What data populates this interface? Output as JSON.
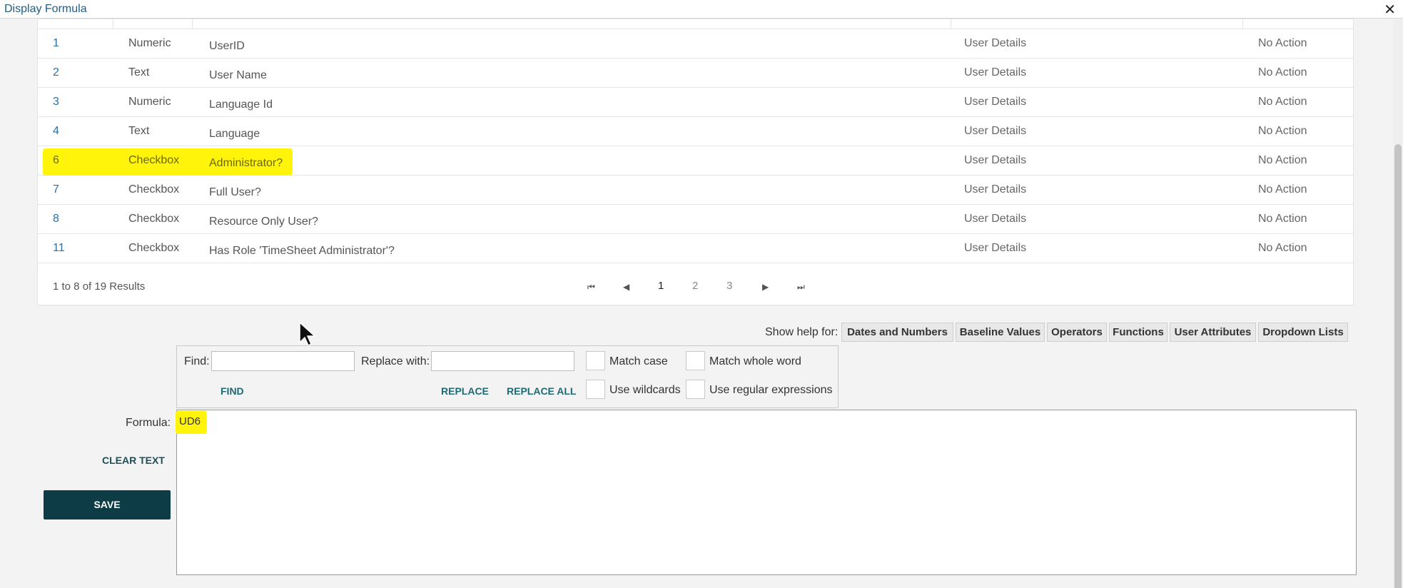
{
  "window": {
    "title": "Display Formula",
    "close_symbol": "✕"
  },
  "table": {
    "rows": [
      {
        "id": "1",
        "type": "Numeric",
        "name": "UserID",
        "source": "User Details",
        "action": "No Action",
        "highlighted": false
      },
      {
        "id": "2",
        "type": "Text",
        "name": "User Name",
        "source": "User Details",
        "action": "No Action",
        "highlighted": false
      },
      {
        "id": "3",
        "type": "Numeric",
        "name": "Language Id",
        "source": "User Details",
        "action": "No Action",
        "highlighted": false
      },
      {
        "id": "4",
        "type": "Text",
        "name": "Language",
        "source": "User Details",
        "action": "No Action",
        "highlighted": false
      },
      {
        "id": "6",
        "type": "Checkbox",
        "name": "Administrator?",
        "source": "User Details",
        "action": "No Action",
        "highlighted": true
      },
      {
        "id": "7",
        "type": "Checkbox",
        "name": "Full User?",
        "source": "User Details",
        "action": "No Action",
        "highlighted": false
      },
      {
        "id": "8",
        "type": "Checkbox",
        "name": "Resource Only User?",
        "source": "User Details",
        "action": "No Action",
        "highlighted": false
      },
      {
        "id": "11",
        "type": "Checkbox",
        "name": "Has Role 'TimeSheet Administrator'?",
        "source": "User Details",
        "action": "No Action",
        "highlighted": false
      }
    ],
    "results_text": "1 to 8 of 19 Results",
    "pager": {
      "first": "⏮",
      "prev": "◀",
      "pages": [
        "1",
        "2",
        "3"
      ],
      "next": "▶",
      "last": "⏭",
      "current_page": "1"
    }
  },
  "help": {
    "label": "Show help for:",
    "buttons": [
      "Dates and Numbers",
      "Baseline Values",
      "Operators",
      "Functions",
      "User Attributes",
      "Dropdown Lists"
    ]
  },
  "find_replace": {
    "find_label": "Find:",
    "find_value": "",
    "replace_label": "Replace with:",
    "replace_value": "",
    "match_case": "Match case",
    "match_whole_word": "Match whole word",
    "use_wildcards": "Use wildcards",
    "use_regex": "Use regular expressions",
    "find_button": "FIND",
    "replace_button": "REPLACE",
    "replace_all_button": "REPLACE ALL"
  },
  "formula": {
    "label": "Formula:",
    "value": "UD6"
  },
  "actions": {
    "clear_text": "CLEAR TEXT",
    "save": "SAVE"
  },
  "colors": {
    "highlight": "#fff40a",
    "save_bg": "#0e3c46",
    "link": "#1d6a72",
    "id_link": "#2a6fa6"
  }
}
